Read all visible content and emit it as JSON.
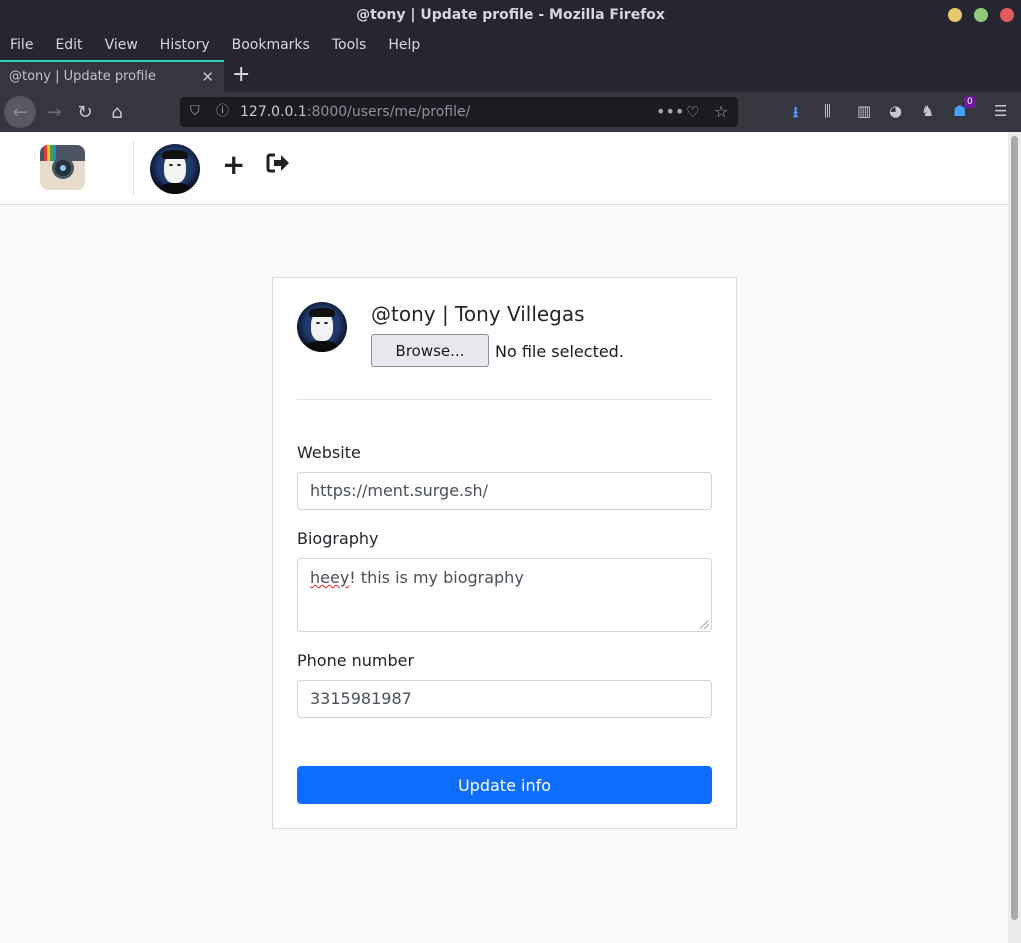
{
  "window": {
    "title": "@tony | Update profile - Mozilla Firefox"
  },
  "menu": [
    "File",
    "Edit",
    "View",
    "History",
    "Bookmarks",
    "Tools",
    "Help"
  ],
  "tab": {
    "title": "@tony | Update profile"
  },
  "url": {
    "host": "127.0.0.1",
    "path": ":8000/users/me/profile/"
  },
  "toolbar": {
    "notification_count": "0"
  },
  "profile": {
    "title": "@tony | Tony Villegas",
    "browse_label": "Browse...",
    "file_status": "No file selected."
  },
  "form": {
    "website_label": "Website",
    "website_value": "https://ment.surge.sh/",
    "bio_label": "Biography",
    "bio_misspelled": "heey",
    "bio_rest": "! this is my biography",
    "phone_label": "Phone number",
    "phone_value": "3315981987",
    "submit_label": "Update info"
  },
  "colors": {
    "primary": "#0d6efd",
    "tab_accent": "#2dd2c2",
    "chrome_dark": "#262632"
  }
}
